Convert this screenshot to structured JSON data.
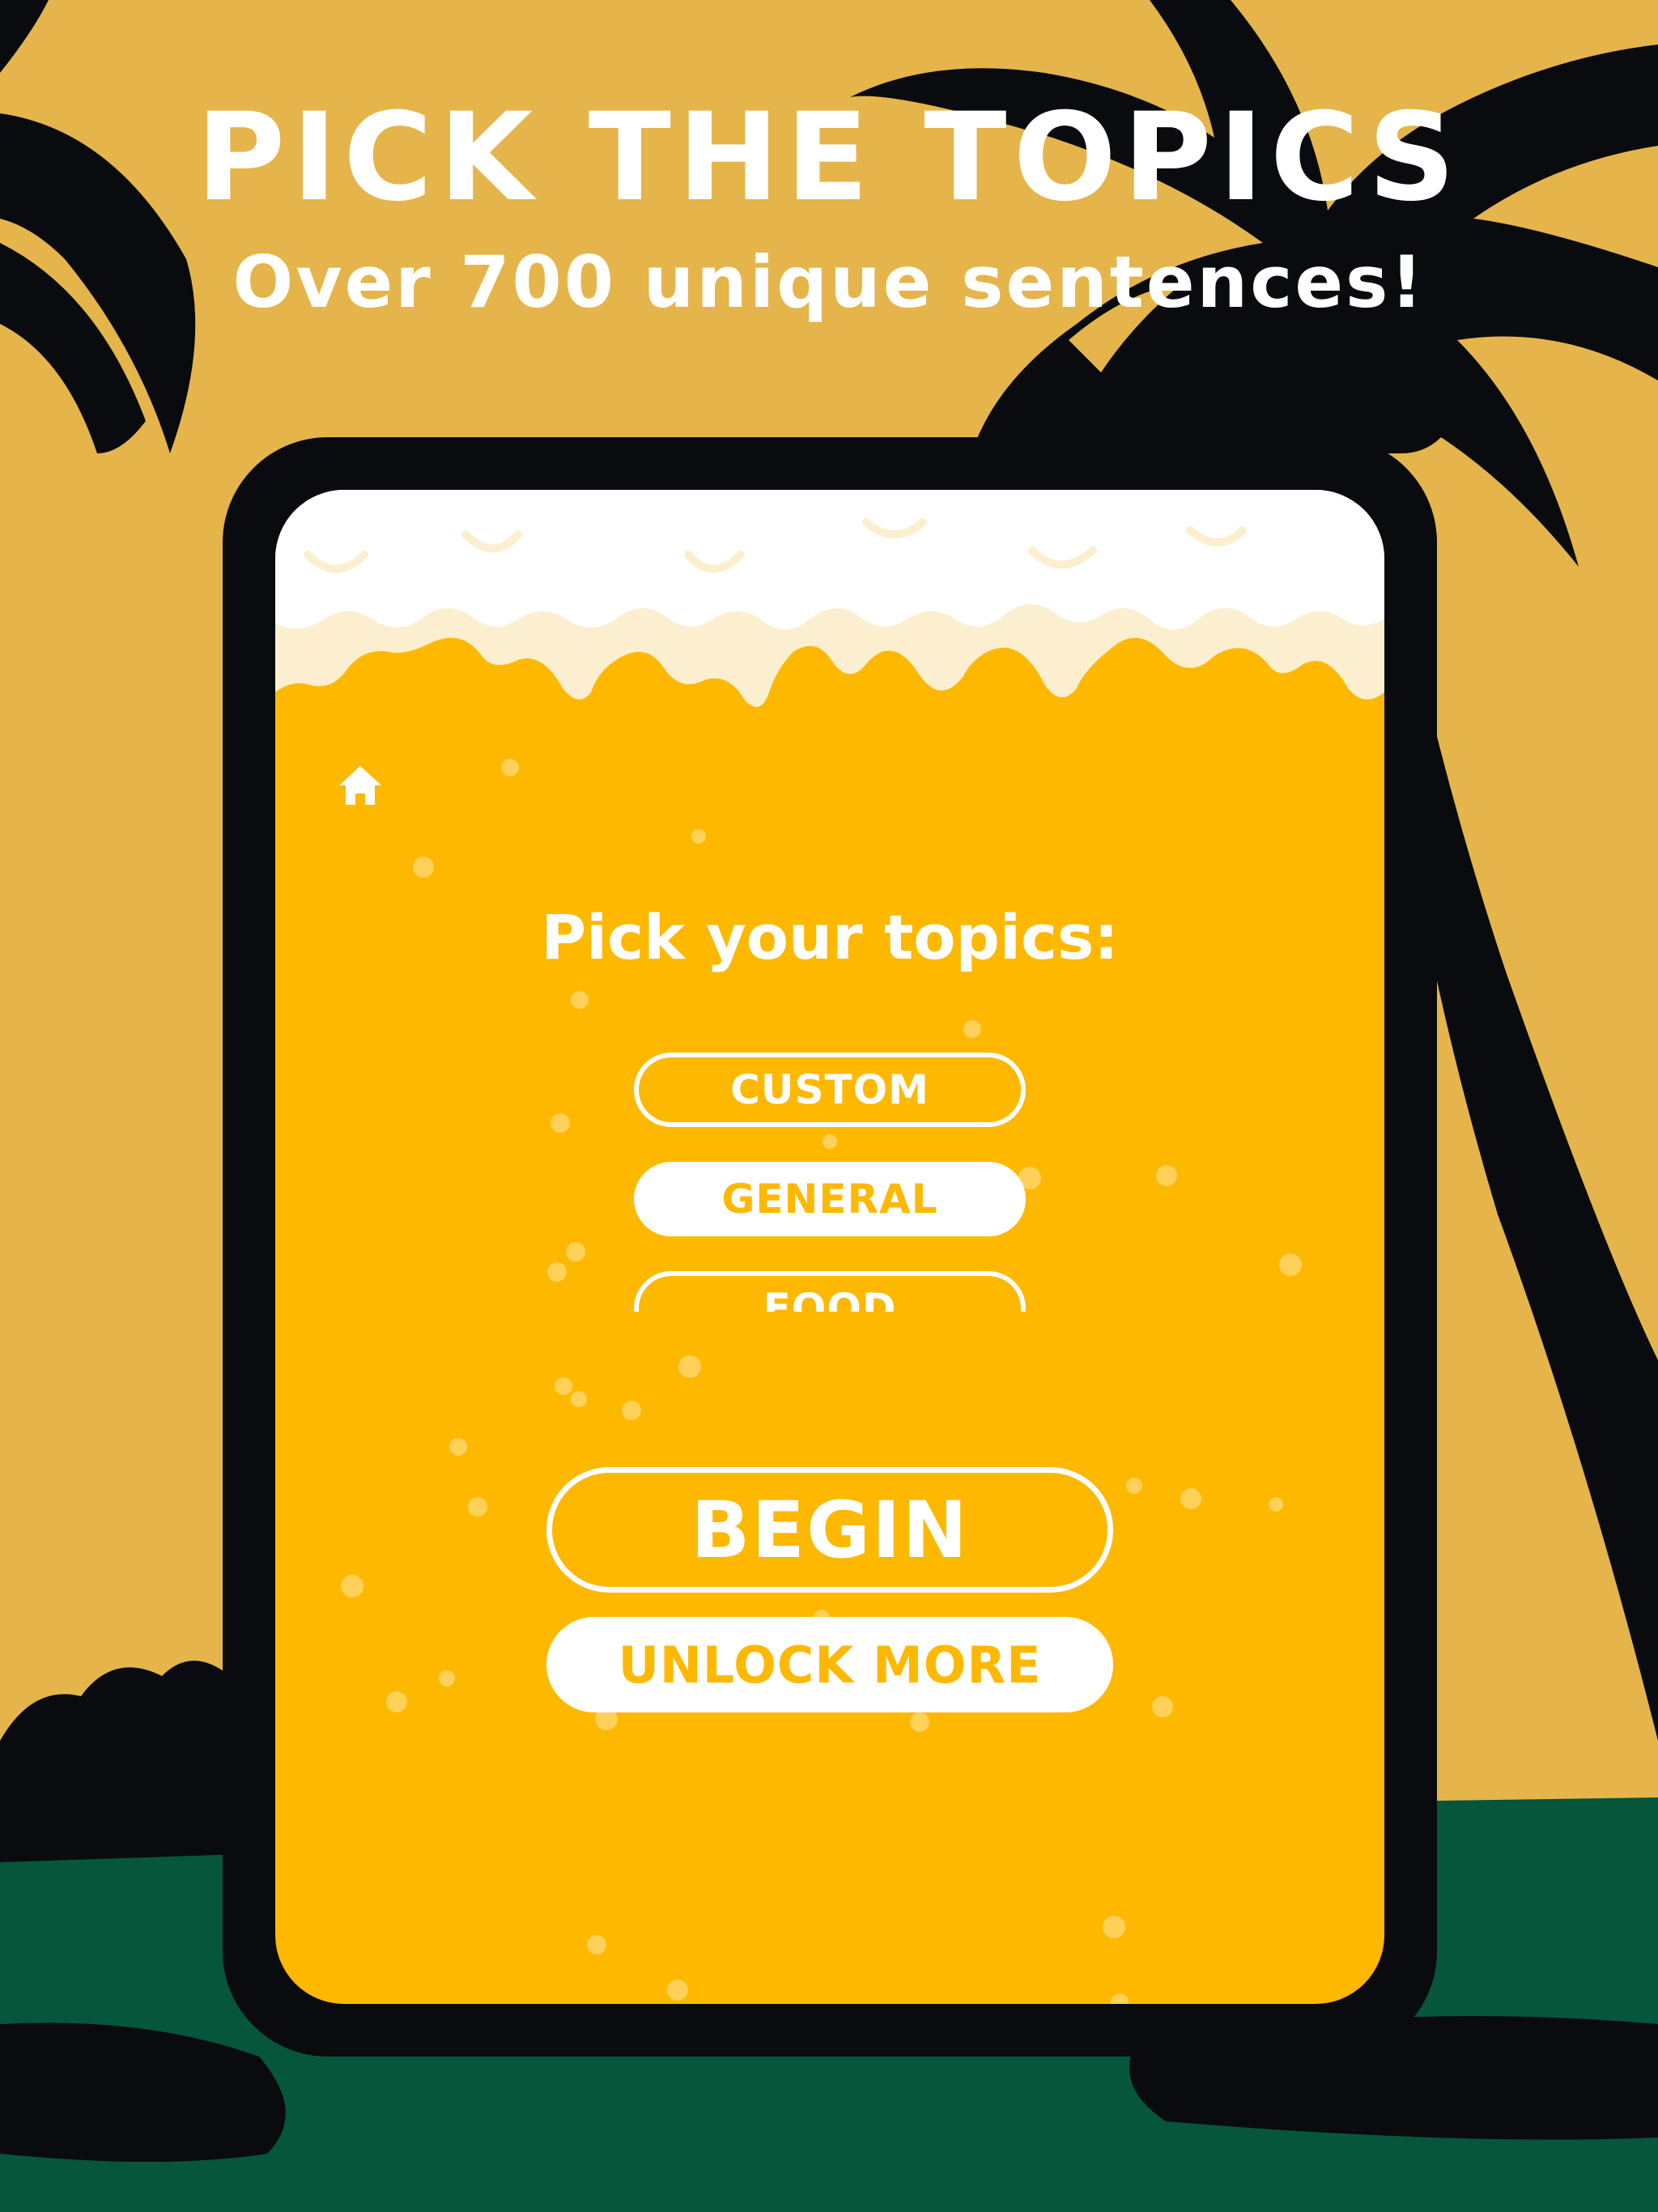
{
  "promo": {
    "headline": "PICK THE TOPICS",
    "subheadline": "Over 700 unique sentences!"
  },
  "app": {
    "heading": "Pick your topics:",
    "topics": [
      {
        "label": "CUSTOM",
        "selected": false
      },
      {
        "label": "GENERAL",
        "selected": true
      },
      {
        "label": "FOOD",
        "selected": false
      }
    ],
    "begin_label": "BEGIN",
    "unlock_label": "UNLOCK MORE"
  },
  "colors": {
    "sky": "#E5B54B",
    "silhouette": "#0A0B0E",
    "ground": "#05563A",
    "beer": "#FFB800",
    "foam": "#FFFFFF",
    "foam_shadow": "#FBEFCF"
  },
  "icons": {
    "home": "home-icon"
  }
}
